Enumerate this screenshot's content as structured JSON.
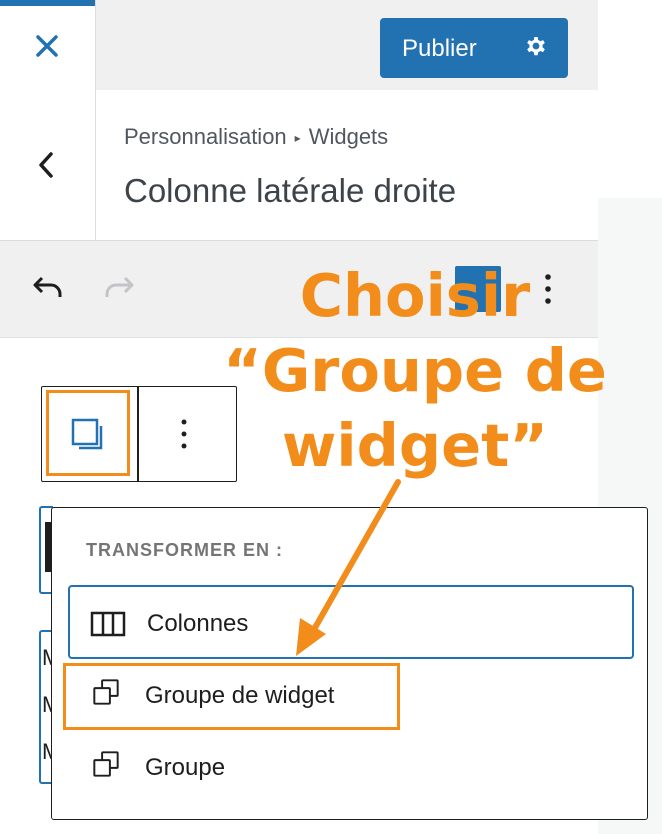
{
  "topbar": {
    "publish_label": "Publier",
    "close_icon": "close-icon",
    "settings_icon": "gear-icon"
  },
  "header": {
    "breadcrumb_root": "Personnalisation",
    "breadcrumb_child": "Widgets",
    "title": "Colonne latérale droite"
  },
  "toolbar": {
    "undo_icon": "undo-icon",
    "redo_icon": "redo-icon",
    "options_icon": "more-vertical-icon"
  },
  "transform_menu": {
    "heading": "TRANSFORMER EN :",
    "items": [
      {
        "label": "Colonnes",
        "icon": "columns-icon"
      },
      {
        "label": "Groupe de widget",
        "icon": "group-icon"
      },
      {
        "label": "Groupe",
        "icon": "group-icon"
      }
    ]
  },
  "annotation": {
    "line1": "Choisir",
    "line2": "“Groupe de",
    "line3": "widget”"
  },
  "colors": {
    "accent": "#2271b1",
    "highlight": "#f28d1c"
  }
}
